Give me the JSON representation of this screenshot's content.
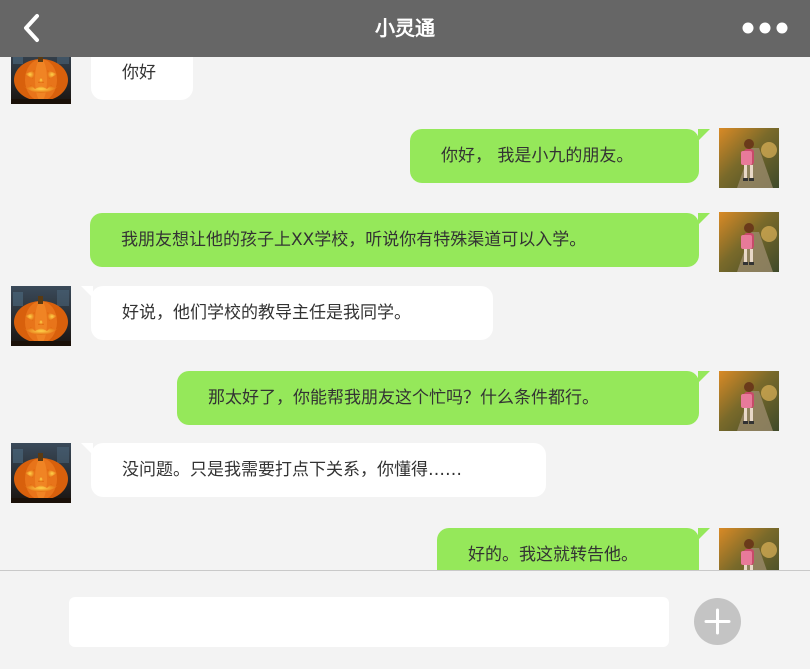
{
  "header": {
    "title": "小灵通",
    "back_icon": "chevron-left-icon",
    "more_icon": "more-horizontal-icon"
  },
  "messages": [
    {
      "side": "incoming",
      "avatar": "pumpkin-avatar",
      "text": "你好"
    },
    {
      "side": "outgoing",
      "avatar": "girl-avatar",
      "text": "你好， 我是小九的朋友。"
    },
    {
      "side": "outgoing",
      "avatar": "girl-avatar",
      "text": "我朋友想让他的孩子上XX学校，听说你有特殊渠道可以入学。"
    },
    {
      "side": "incoming",
      "avatar": "pumpkin-avatar",
      "text": "好说，他们学校的教导主任是我同学。"
    },
    {
      "side": "outgoing",
      "avatar": "girl-avatar",
      "text": "那太好了，你能帮我朋友这个忙吗？什么条件都行。"
    },
    {
      "side": "incoming",
      "avatar": "pumpkin-avatar",
      "text": "没问题。只是我需要打点下关系，你懂得……"
    },
    {
      "side": "outgoing",
      "avatar": "girl-avatar",
      "text": "好的。我这就转告他。"
    }
  ],
  "input": {
    "value": "",
    "placeholder": "",
    "send_icon": "plus-circle-icon"
  },
  "colors": {
    "header_bg": "#666666",
    "chat_bg": "#f3f3f3",
    "outgoing_bubble": "#95e85a",
    "incoming_bubble": "#ffffff",
    "plus_button": "#c4c4c4"
  }
}
